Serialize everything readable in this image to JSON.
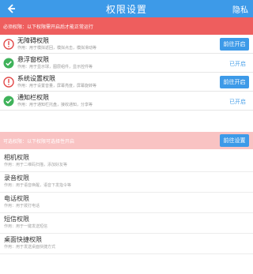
{
  "header": {
    "title": "权限设置",
    "privacy_label": "隐私"
  },
  "banner_required": "必须权限：以下权限需开启后才能正常运行",
  "required_permissions": [
    {
      "name": "无障碍权限",
      "desc": "作用：用于模拟返回，模拟点击，模拟滑动等",
      "status_icon": "warning-icon",
      "action": "前往开启",
      "has_button": true
    },
    {
      "name": "悬浮窗权限",
      "desc": "作用：用于显示球，图层组件，显示控件等",
      "status_icon": "check-icon",
      "action": "已开启",
      "has_button": false
    },
    {
      "name": "系统设置权限",
      "desc": "作用：用于设置音量，屏幕亮度，屏幕旋转等",
      "status_icon": "warning-icon",
      "action": "前往开启",
      "has_button": true
    },
    {
      "name": "通知栏权限",
      "desc": "作用：用于通知栏托盘，接收通知，分享等",
      "status_icon": "check-icon",
      "action": "已开启",
      "has_button": false
    }
  ],
  "banner_optional": "可选权限：以下权限可选择性开启",
  "optional_settings_button": "前往设置",
  "optional_permissions": [
    {
      "name": "相机权限",
      "desc": "作用：用于二维码扫描，添加好友等"
    },
    {
      "name": "录音权限",
      "desc": "作用：用于语音唤醒，语音下发指令等"
    },
    {
      "name": "电话权限",
      "desc": "作用：用于拨打电话"
    },
    {
      "name": "短信权限",
      "desc": "作用：用于一键发送短信"
    },
    {
      "name": "桌面快捷权限",
      "desc": "作用：用于发送桌面快捷方式"
    }
  ],
  "colors": {
    "primary": "#3d9ae8",
    "required_banner": "#ee5e5e",
    "optional_banner": "#f9c3c3",
    "warning": "#e24a4a",
    "ok": "#3fb25a"
  }
}
